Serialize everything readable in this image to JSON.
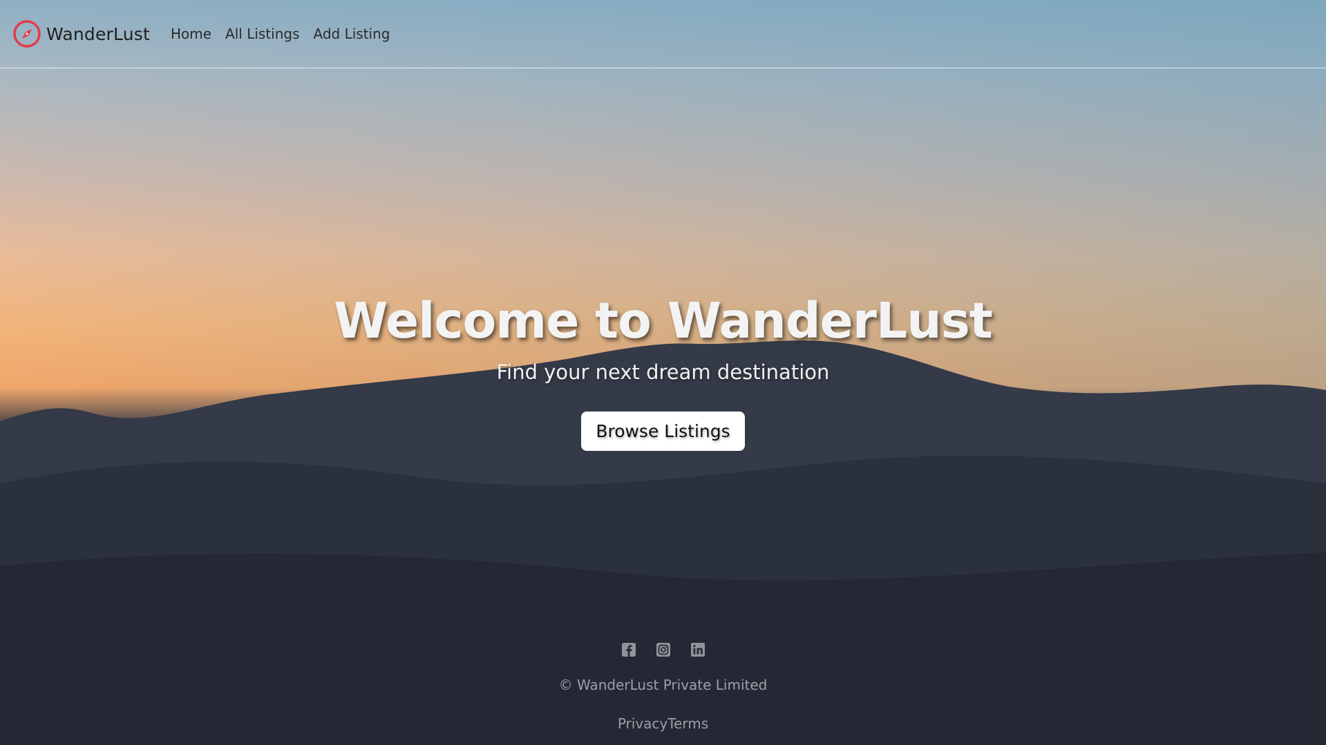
{
  "brand": {
    "name": "WanderLust",
    "icon": "compass-icon",
    "accent_color": "#e23b4a"
  },
  "nav": {
    "items": [
      {
        "label": "Home"
      },
      {
        "label": "All Listings"
      },
      {
        "label": "Add Listing"
      }
    ]
  },
  "hero": {
    "title": "Welcome to WanderLust",
    "subtitle": "Find your next dream destination",
    "cta_label": "Browse Listings"
  },
  "footer": {
    "socials": [
      {
        "icon": "facebook-icon"
      },
      {
        "icon": "instagram-icon"
      },
      {
        "icon": "linkedin-icon"
      }
    ],
    "copyright": "© WanderLust Private Limited",
    "links": [
      {
        "label": "Privacy"
      },
      {
        "label": "Terms"
      }
    ]
  }
}
